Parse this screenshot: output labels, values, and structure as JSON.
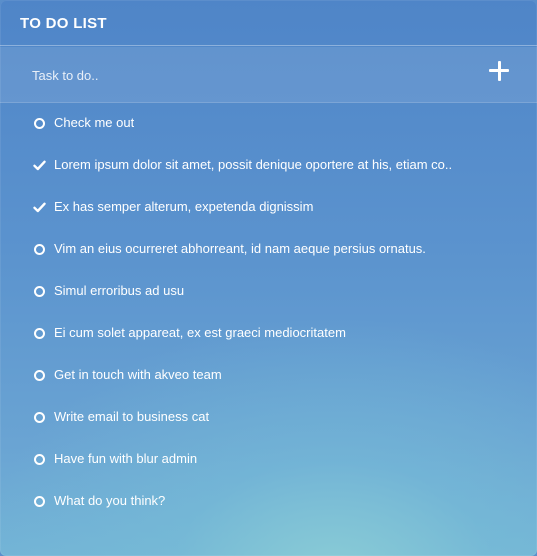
{
  "header": {
    "title": "TO DO LIST"
  },
  "task_input": {
    "placeholder": "Task to do..",
    "value": ""
  },
  "add_button": {
    "icon": "plus-icon"
  },
  "todos": [
    {
      "text": "Check me out",
      "done": false
    },
    {
      "text": "Lorem ipsum dolor sit amet, possit denique oportere at his, etiam co..",
      "done": true
    },
    {
      "text": "Ex has semper alterum, expetenda dignissim",
      "done": true
    },
    {
      "text": "Vim an eius ocurreret abhorreant, id nam aeque persius ornatus.",
      "done": false
    },
    {
      "text": "Simul erroribus ad usu",
      "done": false
    },
    {
      "text": "Ei cum solet appareat, ex est graeci mediocritatem",
      "done": false
    },
    {
      "text": "Get in touch with akveo team",
      "done": false
    },
    {
      "text": "Write email to business cat",
      "done": false
    },
    {
      "text": "Have fun with blur admin",
      "done": false
    },
    {
      "text": "What do you think?",
      "done": false
    }
  ],
  "colors": {
    "text": "#ffffff",
    "panel_top": "#4f85c8",
    "panel_bottom": "#73b4d6"
  }
}
